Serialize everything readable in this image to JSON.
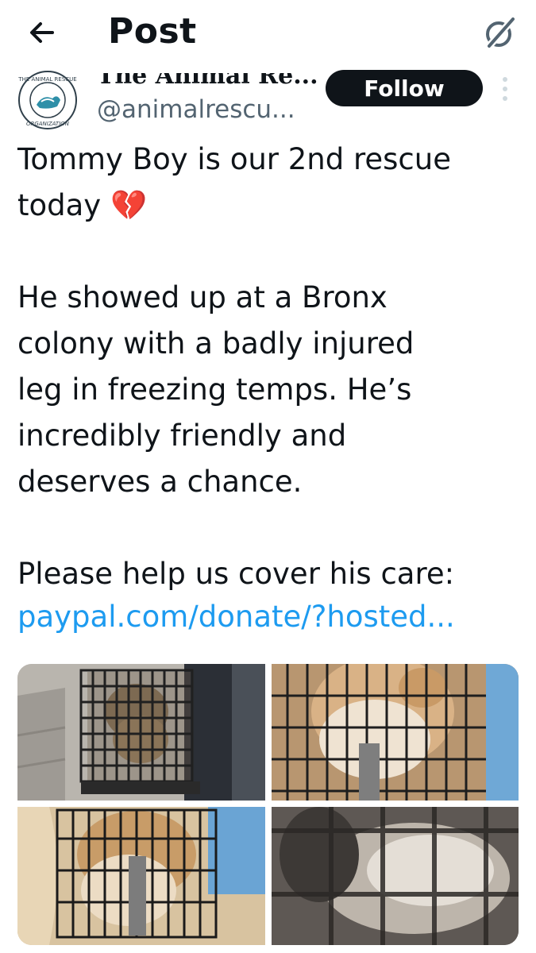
{
  "header": {
    "title": "Post",
    "back_icon": "arrow-left-icon",
    "grok_icon": "grok-slash-icon"
  },
  "author": {
    "name": "The Animal Re...",
    "handle": "@animalrescu...",
    "follow_label": "Follow",
    "avatar_text_top": "THE ANIMAL RESCUE",
    "avatar_text_bottom": "ORGANIZATION"
  },
  "tweet": {
    "text": "Tommy Boy is our 2nd rescue\ntoday 💔\n\nHe showed up at a Bronx\ncolony with a badly injured\nleg in freezing temps. He’s\nincredibly friendly and\ndeserves a chance.\n\nPlease help us cover his care:",
    "link": "paypal.com/donate/?hosted..."
  },
  "media": {
    "count": 4
  },
  "colors": {
    "text": "#0f1419",
    "secondary": "#536471",
    "link": "#1d9bf0",
    "button": "#0f1419"
  }
}
